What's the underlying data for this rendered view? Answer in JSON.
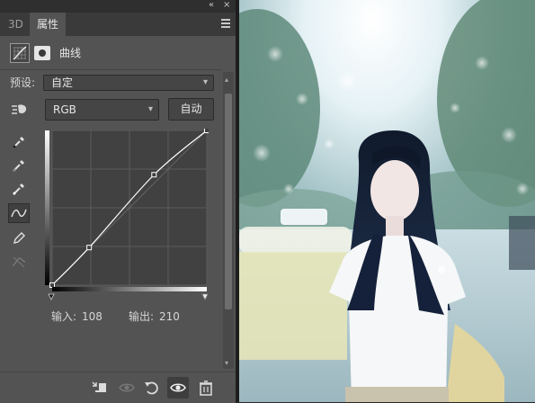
{
  "panel": {
    "collapse_glyph": "«",
    "close_glyph": "×",
    "tabs": [
      {
        "label": "3D",
        "active": false
      },
      {
        "label": "属性",
        "active": true
      }
    ],
    "adjustment": {
      "name": "曲线",
      "icons": [
        "curves-adjustment-icon",
        "layer-mask-icon"
      ]
    },
    "preset": {
      "label": "预设:",
      "value": "自定"
    },
    "channel": {
      "value": "RGB",
      "icon": "on-image-adjust-icon"
    },
    "auto_button": "自动",
    "tools": [
      "black-point-eyedropper-icon",
      "gray-point-eyedropper-icon",
      "white-point-eyedropper-icon",
      "curve-point-mode-icon",
      "pencil-draw-icon",
      "smooth-curve-icon"
    ],
    "input": {
      "label": "输入:",
      "value": "108"
    },
    "output": {
      "label": "输出:",
      "value": "210"
    },
    "bottom_icons": [
      "clip-to-layer-icon",
      "view-previous-state-icon",
      "reset-icon",
      "visibility-eye-icon",
      "trash-icon"
    ]
  },
  "curve": {
    "range": [
      0,
      255
    ],
    "points": [
      [
        0,
        0
      ],
      [
        61,
        62
      ],
      [
        168,
        182
      ],
      [
        255,
        255
      ]
    ]
  },
  "colors": {
    "panel_bg": "#535353",
    "graph_bg": "#414141",
    "grid": "#5c5c5c",
    "curve": "#ffffff"
  }
}
